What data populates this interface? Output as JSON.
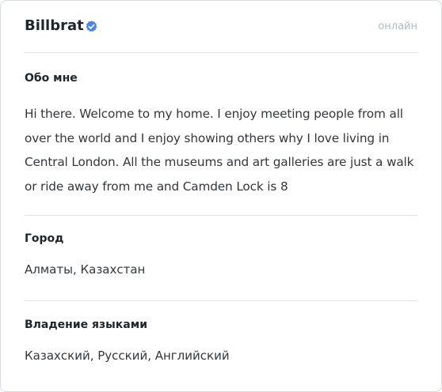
{
  "profile": {
    "username": "Billbrat",
    "verified_icon": "verified-badge-icon",
    "status": "онлайн",
    "accent_color": "#4285f4"
  },
  "about": {
    "title": "Обо мне",
    "text": "Hi there. Welcome to my home. I enjoy meeting people from all over the world and I enjoy showing others why I love living in Central London. All the museums and art galleries are just a walk or ride away from me and Camden Lock is 8"
  },
  "city": {
    "title": "Город",
    "value": "Алматы, Казахстан"
  },
  "languages": {
    "title": "Владение языками",
    "value": "Казахский, Русский, Английский"
  }
}
